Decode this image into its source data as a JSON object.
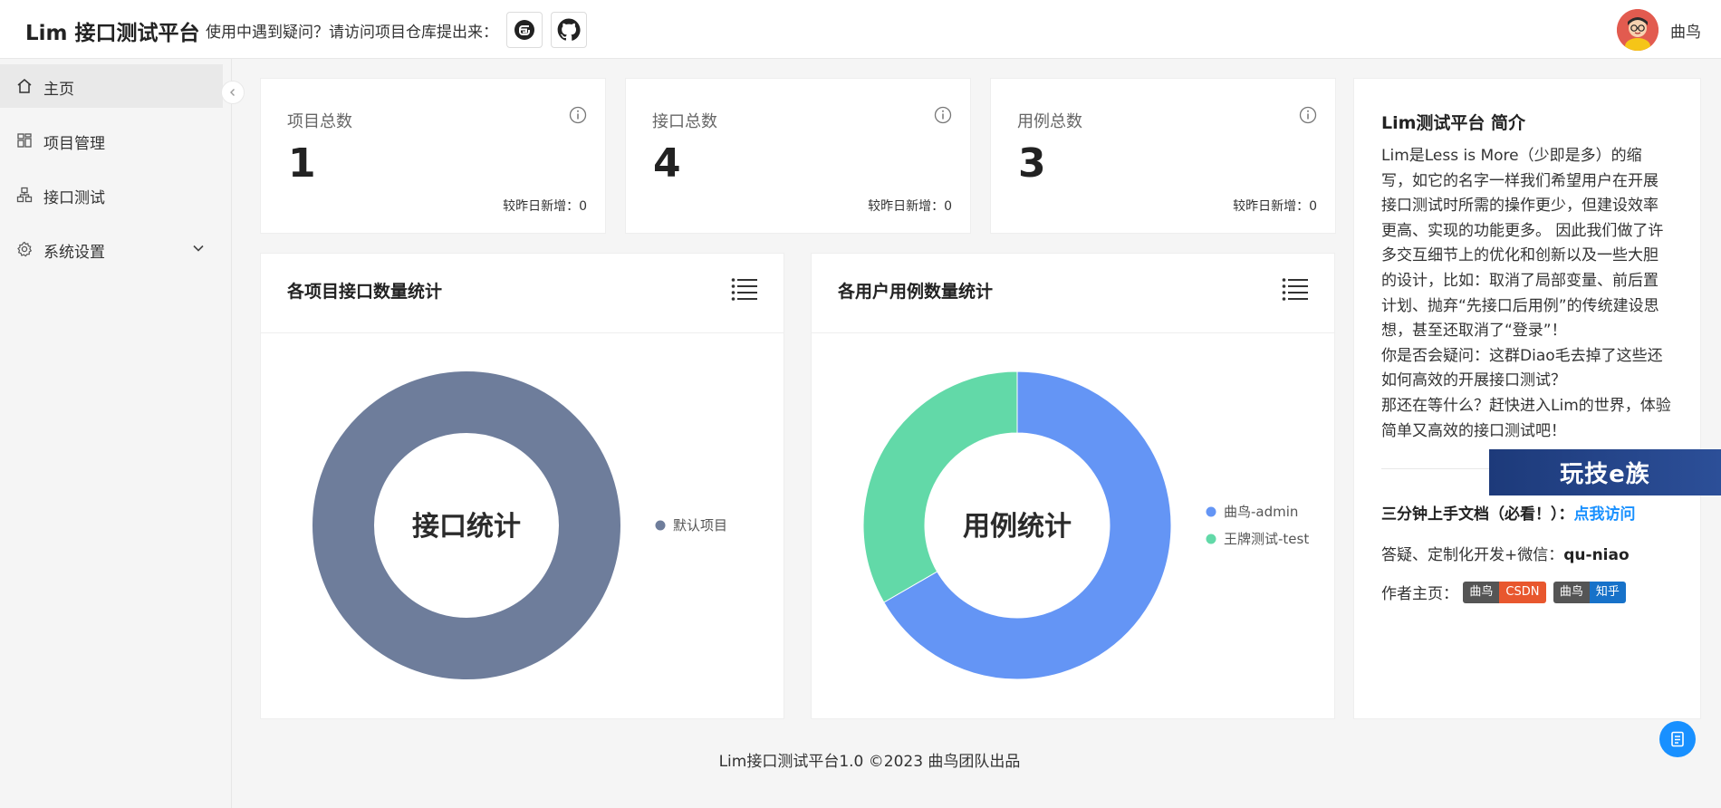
{
  "header": {
    "title": "Lim 接口测试平台",
    "help_text": "使用中遇到疑问？请访问项目仓库提出来：",
    "user_name": "曲鸟",
    "icons": [
      "gitee-icon",
      "github-icon",
      "avatar"
    ]
  },
  "sidebar": {
    "items": [
      {
        "label": "主页",
        "icon": "home-icon",
        "active": true
      },
      {
        "label": "项目管理",
        "icon": "grid-icon"
      },
      {
        "label": "接口测试",
        "icon": "sitemap-icon"
      },
      {
        "label": "系统设置",
        "icon": "gear-icon"
      }
    ]
  },
  "stats": [
    {
      "label": "项目总数",
      "value": "1",
      "sub": "较昨日新增：0"
    },
    {
      "label": "接口总数",
      "value": "4",
      "sub": "较昨日新增：0"
    },
    {
      "label": "用例总数",
      "value": "3",
      "sub": "较昨日新增：0"
    }
  ],
  "chart_data": [
    {
      "type": "pie",
      "title": "各项目接口数量统计",
      "center_label": "接口统计",
      "categories": [
        "默认项目"
      ],
      "values": [
        4
      ],
      "colors": [
        "#6e7d9b"
      ],
      "legend": "right"
    },
    {
      "type": "pie",
      "title": "各用户用例数量统计",
      "center_label": "用例统计",
      "categories": [
        "曲鸟-admin",
        "王牌测试-test"
      ],
      "values": [
        2,
        1
      ],
      "colors": [
        "#6495f5",
        "#62d9a8"
      ],
      "legend": "right"
    }
  ],
  "intro": {
    "title": "Lim测试平台 简介",
    "body": "Lim是Less is More（少即是多）的缩写，如它的名字一样我们希望用户在开展接口测试时所需的操作更少，但建设效率更高、实现的功能更多。 因此我们做了许多交互细节上的优化和创新以及一些大胆的设计，比如：取消了局部变量、前后置计划、抛弃“先接口后用例”的传统建设思想，甚至还取消了“登录”！\n你是否会疑问：这群Diao毛去掉了这些还如何高效的开展接口测试？\n那还在等什么？赶快进入Lim的世界，体验简单又高效的接口测试吧！",
    "doc_label": "三分钟上手文档（必看！）：",
    "doc_link": "点我访问",
    "contact_label": "答疑、定制化开发+微信：",
    "contact_value": "qu-niao",
    "author_label": "作者主页：",
    "badges": [
      {
        "left": "曲鸟",
        "right": "CSDN",
        "color": "#e8572e"
      },
      {
        "left": "曲鸟",
        "right": "知乎",
        "color": "#1772c9"
      }
    ],
    "watermark": "玩技e族"
  },
  "footer": "Lim接口测试平台1.0 ©2023 曲鸟团队出品"
}
